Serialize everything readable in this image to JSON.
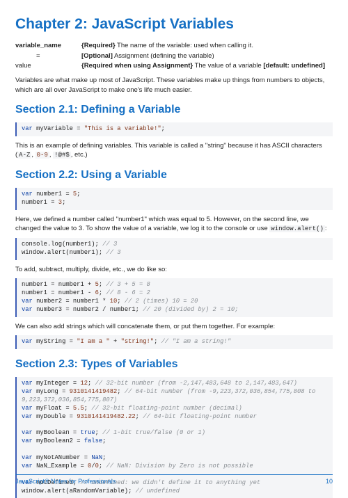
{
  "chapter_title": "Chapter 2: JavaScript Variables",
  "params": {
    "r1_name": "variable_name",
    "r1_desc_bold": "{Required}",
    "r1_desc_rest": " The name of the variable: used when calling it.",
    "r2_name": "=",
    "r2_desc_bold": "[Optional]",
    "r2_desc_rest": " Assignment (defining the variable)",
    "r3_name": "value",
    "r3_desc_bold": "{Required when using Assignment}",
    "r3_desc_rest": " The value of a variable ",
    "r3_desc_tail_bold": "[default: undefined]"
  },
  "intro": "Variables are what make up most of JavaScript. These variables make up things from numbers to objects, which are all over JavaScript to make one's life much easier.",
  "s1": {
    "title": "Section 2.1: Defining a Variable",
    "code1": {
      "kw": "var",
      "ident": " myVariable ",
      "eq": "=",
      "sp": " ",
      "str": "\"This is a variable!\"",
      "semi": ";"
    },
    "p1_a": "This is an example of defining variables. This variable is called a \"string\" because it has ASCII characters (",
    "p1_code1": "A-Z",
    "p1_b": ", ",
    "p1_code2": "0-9",
    "p1_c": ", ",
    "p1_code3": "!@#$",
    "p1_d": ", etc.)"
  },
  "s2": {
    "title": "Section 2.2: Using a Variable",
    "p1_a": "Here, we defined a number called \"number1\" which was equal to 5. However, on the second line, we changed the value to 3. To show the value of a variable, we log it to the console or use ",
    "p1_code": "window.alert()",
    "p1_b": ":",
    "p2": "To add, subtract, multiply, divide, etc., we do like so:",
    "p3": "We can also add strings which will concatenate them, or put them together. For example:"
  },
  "s3": {
    "title": "Section 2.3: Types of Variables"
  },
  "footer": {
    "left": "JavaScript® Notes for Professionals",
    "right": "10"
  }
}
